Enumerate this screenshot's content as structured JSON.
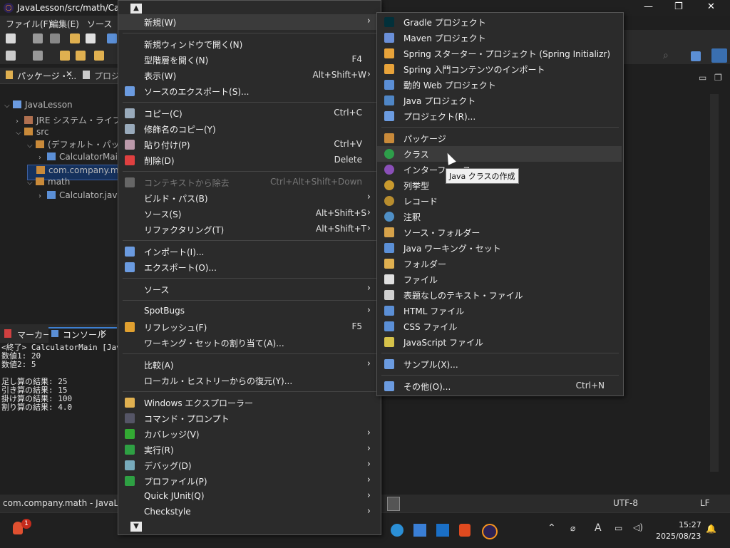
{
  "window": {
    "title": "JavaLesson/src/math/Calcu"
  },
  "menubar": [
    "ファイル(F)",
    "編集(E)",
    "ソース(S)"
  ],
  "views": {
    "package_tab": "パッケージ・...",
    "project_tab": "プロジ"
  },
  "tree": [
    {
      "label": "JavaLesson",
      "indent": 0,
      "arrow": "⌵"
    },
    {
      "label": "JRE システム・ライブラリー",
      "indent": 1,
      "arrow": "›"
    },
    {
      "label": "src",
      "indent": 1,
      "arrow": "⌵"
    },
    {
      "label": "(デフォルト・パッケージ",
      "indent": 2,
      "arrow": "⌵"
    },
    {
      "label": "CalculatorMain",
      "indent": 3,
      "arrow": "›"
    },
    {
      "label": "com.company.ma",
      "indent": 2,
      "arrow": "",
      "selected": true
    },
    {
      "label": "math",
      "indent": 2,
      "arrow": "⌵"
    },
    {
      "label": "Calculator.java",
      "indent": 3,
      "arrow": "›"
    }
  ],
  "console_tabs": {
    "markers": "マーカー",
    "console": "コンソール"
  },
  "console_lines": [
    "<終了> CalculatorMain [Java ア",
    "数値1: 20",
    "数値2: 5",
    "",
    "足し算の結果: 25",
    "引き算の結果: 15",
    "掛け算の結果: 100",
    "割り算の結果: 4.0"
  ],
  "context_menu": [
    {
      "label": "新規(W)",
      "submenu": true,
      "highlight": true
    },
    {
      "sep": true
    },
    {
      "label": "新規ウィンドウで開く(N)"
    },
    {
      "label": "型階層を開く(N)",
      "shortcut": "F4"
    },
    {
      "label": "表示(W)",
      "shortcut": "Alt+Shift+W",
      "submenu": true
    },
    {
      "label": "ソースのエクスポート(S)...",
      "icon": "export-icon"
    },
    {
      "sep": true
    },
    {
      "label": "コピー(C)",
      "shortcut": "Ctrl+C",
      "icon": "copy-icon"
    },
    {
      "label": "修飾名のコピー(Y)",
      "icon": "copy-qualified-icon"
    },
    {
      "label": "貼り付け(P)",
      "shortcut": "Ctrl+V",
      "icon": "paste-icon"
    },
    {
      "label": "削除(D)",
      "shortcut": "Delete",
      "icon": "delete-icon"
    },
    {
      "sep": true
    },
    {
      "label": "コンテキストから除去",
      "shortcut": "Ctrl+Alt+Shift+Down",
      "disabled": true,
      "icon": "remove-context-icon"
    },
    {
      "label": "ビルド・パス(B)",
      "submenu": true
    },
    {
      "label": "ソース(S)",
      "shortcut": "Alt+Shift+S",
      "submenu": true
    },
    {
      "label": "リファクタリング(T)",
      "shortcut": "Alt+Shift+T",
      "submenu": true
    },
    {
      "sep": true
    },
    {
      "label": "インポート(I)...",
      "icon": "import-icon"
    },
    {
      "label": "エクスポート(O)...",
      "icon": "export-icon"
    },
    {
      "sep": true
    },
    {
      "label": "ソース",
      "submenu": true
    },
    {
      "sep": true
    },
    {
      "label": "SpotBugs",
      "submenu": true
    },
    {
      "label": "リフレッシュ(F)",
      "shortcut": "F5",
      "icon": "refresh-icon"
    },
    {
      "label": "ワーキング・セットの割り当て(A)..."
    },
    {
      "sep": true
    },
    {
      "label": "比較(A)",
      "submenu": true
    },
    {
      "label": "ローカル・ヒストリーからの復元(Y)..."
    },
    {
      "sep": true
    },
    {
      "label": "Windows エクスプローラー",
      "icon": "folder-icon"
    },
    {
      "label": "コマンド・プロンプト",
      "icon": "terminal-icon"
    },
    {
      "label": "カバレッジ(V)",
      "submenu": true,
      "icon": "coverage-icon"
    },
    {
      "label": "実行(R)",
      "submenu": true,
      "icon": "run-icon"
    },
    {
      "label": "デバッグ(D)",
      "submenu": true,
      "icon": "debug-icon"
    },
    {
      "label": "プロファイル(P)",
      "submenu": true,
      "icon": "profile-icon"
    },
    {
      "label": "Quick JUnit(Q)",
      "submenu": true
    },
    {
      "label": "Checkstyle",
      "submenu": true
    }
  ],
  "submenu": [
    {
      "label": "Gradle プロジェクト",
      "icon": "gradle-icon"
    },
    {
      "label": "Maven プロジェクト",
      "icon": "maven-icon"
    },
    {
      "label": "Spring スターター・プロジェクト (Spring Initializr)",
      "icon": "spring-icon"
    },
    {
      "label": "Spring 入門コンテンツのインポート",
      "icon": "spring-icon"
    },
    {
      "label": "動的 Web プロジェクト",
      "icon": "web-project-icon"
    },
    {
      "label": "Java プロジェクト",
      "icon": "java-project-icon"
    },
    {
      "label": "プロジェクト(R)...",
      "icon": "project-icon"
    },
    {
      "sep": true
    },
    {
      "label": "パッケージ",
      "icon": "package-icon"
    },
    {
      "label": "クラス",
      "icon": "class-icon",
      "highlight": true
    },
    {
      "label": "インターフェース",
      "icon": "interface-icon"
    },
    {
      "label": "列挙型",
      "icon": "enum-icon"
    },
    {
      "label": "レコード",
      "icon": "record-icon"
    },
    {
      "label": "注釈",
      "icon": "annotation-icon"
    },
    {
      "label": "ソース・フォルダー",
      "icon": "source-folder-icon"
    },
    {
      "label": "Java ワーキング・セット",
      "icon": "working-set-icon"
    },
    {
      "label": "フォルダー",
      "icon": "folder-icon"
    },
    {
      "label": "ファイル",
      "icon": "file-icon"
    },
    {
      "label": "表題なしのテキスト・ファイル",
      "icon": "text-file-icon"
    },
    {
      "label": "HTML ファイル",
      "icon": "html-file-icon"
    },
    {
      "label": "CSS ファイル",
      "icon": "css-file-icon"
    },
    {
      "label": "JavaScript ファイル",
      "icon": "js-file-icon"
    },
    {
      "sep": true
    },
    {
      "label": "サンプル(X)...",
      "icon": "sample-icon"
    },
    {
      "sep": true
    },
    {
      "label": "その他(O)...",
      "shortcut": "Ctrl+N",
      "icon": "other-icon"
    }
  ],
  "tooltip": "Java クラスの作成",
  "status": {
    "left": "com.company.math - JavaLesso",
    "encoding": "UTF-8",
    "line_ending": "LF"
  },
  "taskbar": {
    "time": "15:27",
    "date": "2025/08/23",
    "notification_count": "1"
  },
  "icon_colors": {
    "gradle-icon": "#02303a",
    "maven-icon": "#6a8fd8",
    "spring-icon": "#e8a33a",
    "web-project-icon": "#5b8fd6",
    "java-project-icon": "#4f86c6",
    "project-icon": "#6b9be0",
    "package-icon": "#c98a3a",
    "class-icon": "#2e9e4a",
    "interface-icon": "#8a4fb8",
    "enum-icon": "#c99a2e",
    "record-icon": "#b88d2e",
    "annotation-icon": "#4f8fc6",
    "source-folder-icon": "#d6a24a",
    "working-set-icon": "#5b8fd6",
    "folder-icon": "#e0b050",
    "file-icon": "#e0e0e0",
    "text-file-icon": "#d0d0d0",
    "html-file-icon": "#5b8fd6",
    "css-file-icon": "#5b8fd6",
    "js-file-icon": "#d6c24a",
    "sample-icon": "#6b9be0",
    "other-icon": "#6b9be0",
    "export-icon": "#6b9be0",
    "copy-icon": "#9ab",
    "copy-qualified-icon": "#9ab",
    "paste-icon": "#b9a",
    "delete-icon": "#e04040",
    "remove-context-icon": "#666",
    "import-icon": "#6b9be0",
    "refresh-icon": "#e0a030",
    "terminal-icon": "#556",
    "coverage-icon": "#3a3",
    "run-icon": "#2ea043",
    "debug-icon": "#7ab",
    "profile-icon": "#2ea043"
  }
}
